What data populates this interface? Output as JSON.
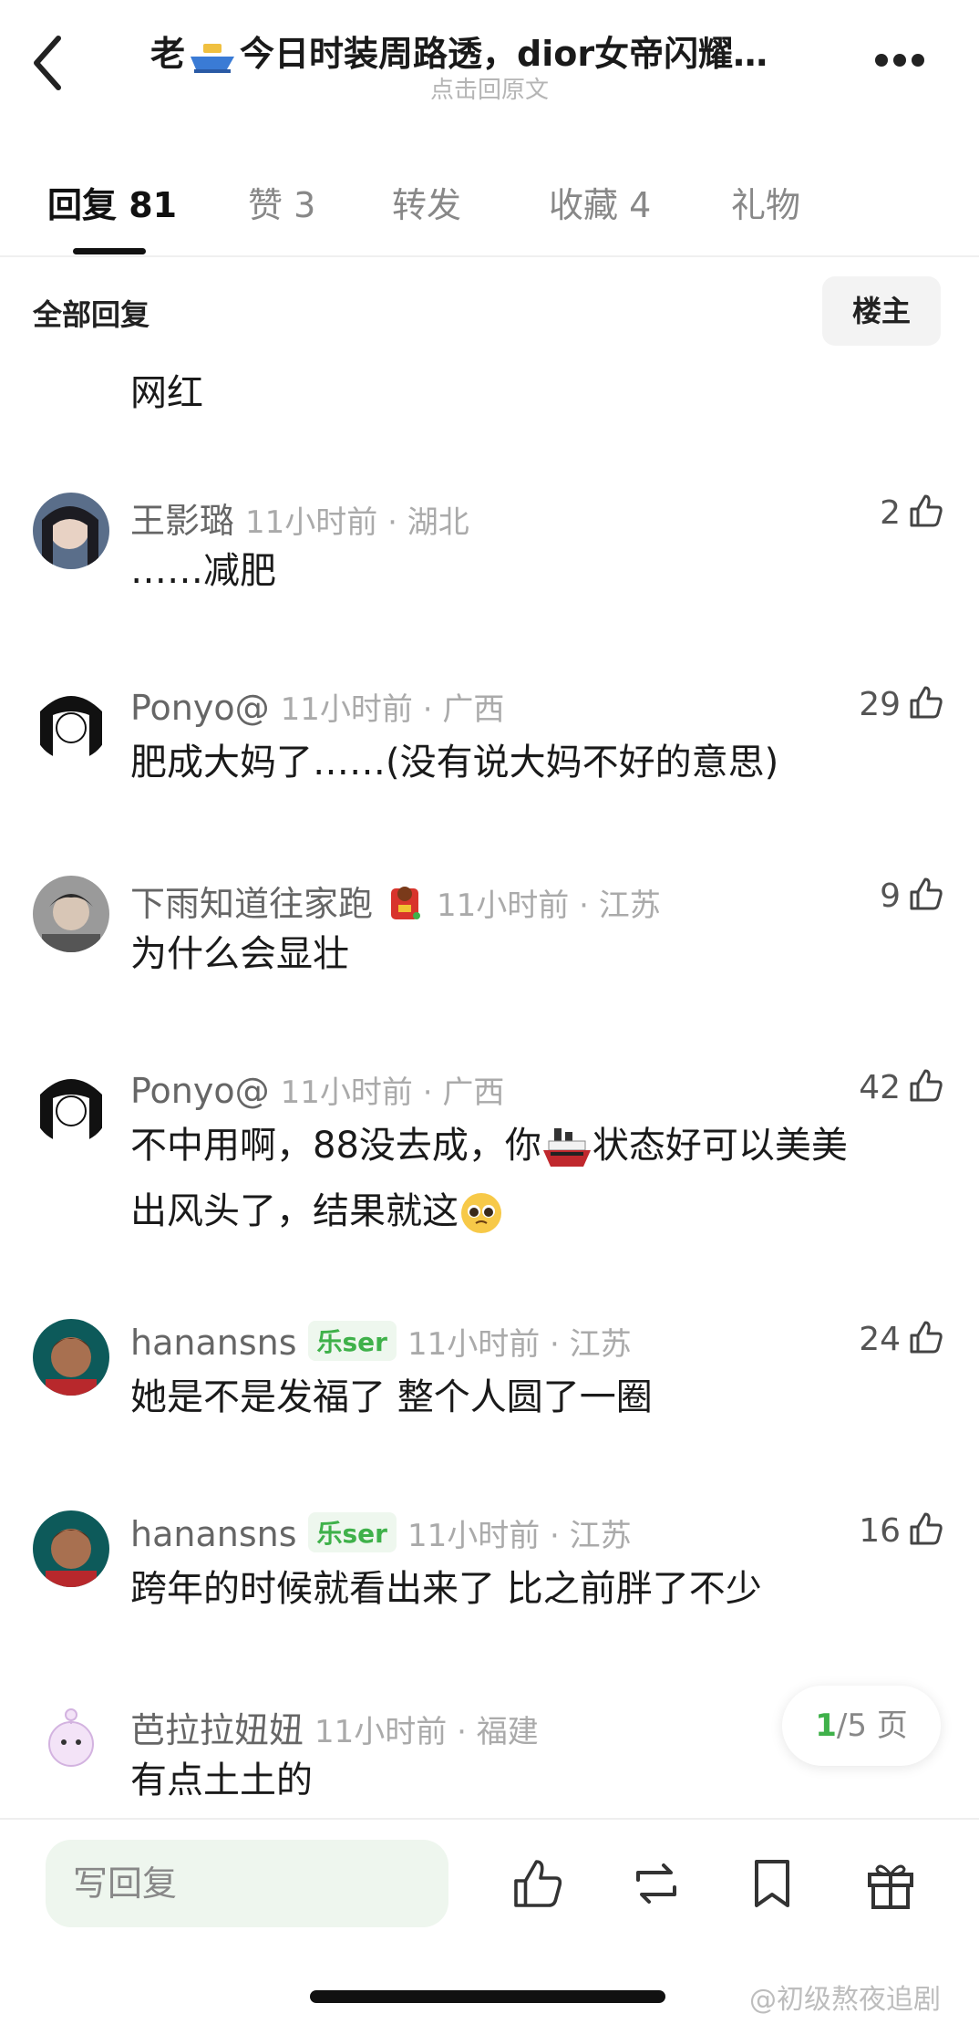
{
  "header": {
    "title_prefix": "老",
    "title_text": "今日时装周路透，dior女帝闪耀…",
    "subtitle": "点击回原文"
  },
  "tabs": [
    {
      "label": "回复 81"
    },
    {
      "label": "赞 3"
    },
    {
      "label": "转发"
    },
    {
      "label": "收藏 4"
    },
    {
      "label": "礼物"
    }
  ],
  "section": {
    "title": "全部回复",
    "owner_button": "楼主"
  },
  "partial_comment": {
    "text": "网红"
  },
  "comments": [
    {
      "user": "王影璐",
      "badge": "",
      "time": "11小时前 · 湖北",
      "likes": "2",
      "text": "……减肥"
    },
    {
      "user": "Ponyo@",
      "badge": "",
      "time": "11小时前 · 广西",
      "likes": "29",
      "text": "肥成大妈了……(没有说大妈不好的意思)"
    },
    {
      "user": "下雨知道往家跑",
      "badge": "",
      "time": "11小时前 · 江苏",
      "likes": "9",
      "text": "为什么会显壮"
    },
    {
      "user": "Ponyo@",
      "badge": "",
      "time": "11小时前 · 广西",
      "likes": "42",
      "text_line1_a": "不中用啊，88没去成，你",
      "text_line1_b": "状态好可以美美",
      "text_line2": "出风头了，结果就这"
    },
    {
      "user": "hanansns",
      "badge": "乐ser",
      "time": "11小时前 · 江苏",
      "likes": "24",
      "text": "她是不是发福了 整个人圆了一圈"
    },
    {
      "user": "hanansns",
      "badge": "乐ser",
      "time": "11小时前 · 江苏",
      "likes": "16",
      "text": "跨年的时候就看出来了 比之前胖了不少"
    },
    {
      "user": "芭拉拉妞妞",
      "badge": "",
      "time": "11小时前 · 福建",
      "likes": "",
      "text": "有点土土的"
    }
  ],
  "pager": {
    "current": "1",
    "total": "/5 页"
  },
  "bottom": {
    "reply_placeholder": "写回复"
  },
  "watermark": "@初级熬夜追剧",
  "colors": {
    "accent_green": "#3fb14a",
    "reply_bg": "#eef6ee"
  },
  "icons": [
    "back-arrow-icon",
    "more-dots-icon",
    "boat-emoji-icon",
    "thumbs-up-icon",
    "repost-icon",
    "bookmark-icon",
    "gift-icon",
    "ship-emoji-icon",
    "pleading-face-emoji-icon",
    "red-envelope-badge-icon"
  ]
}
